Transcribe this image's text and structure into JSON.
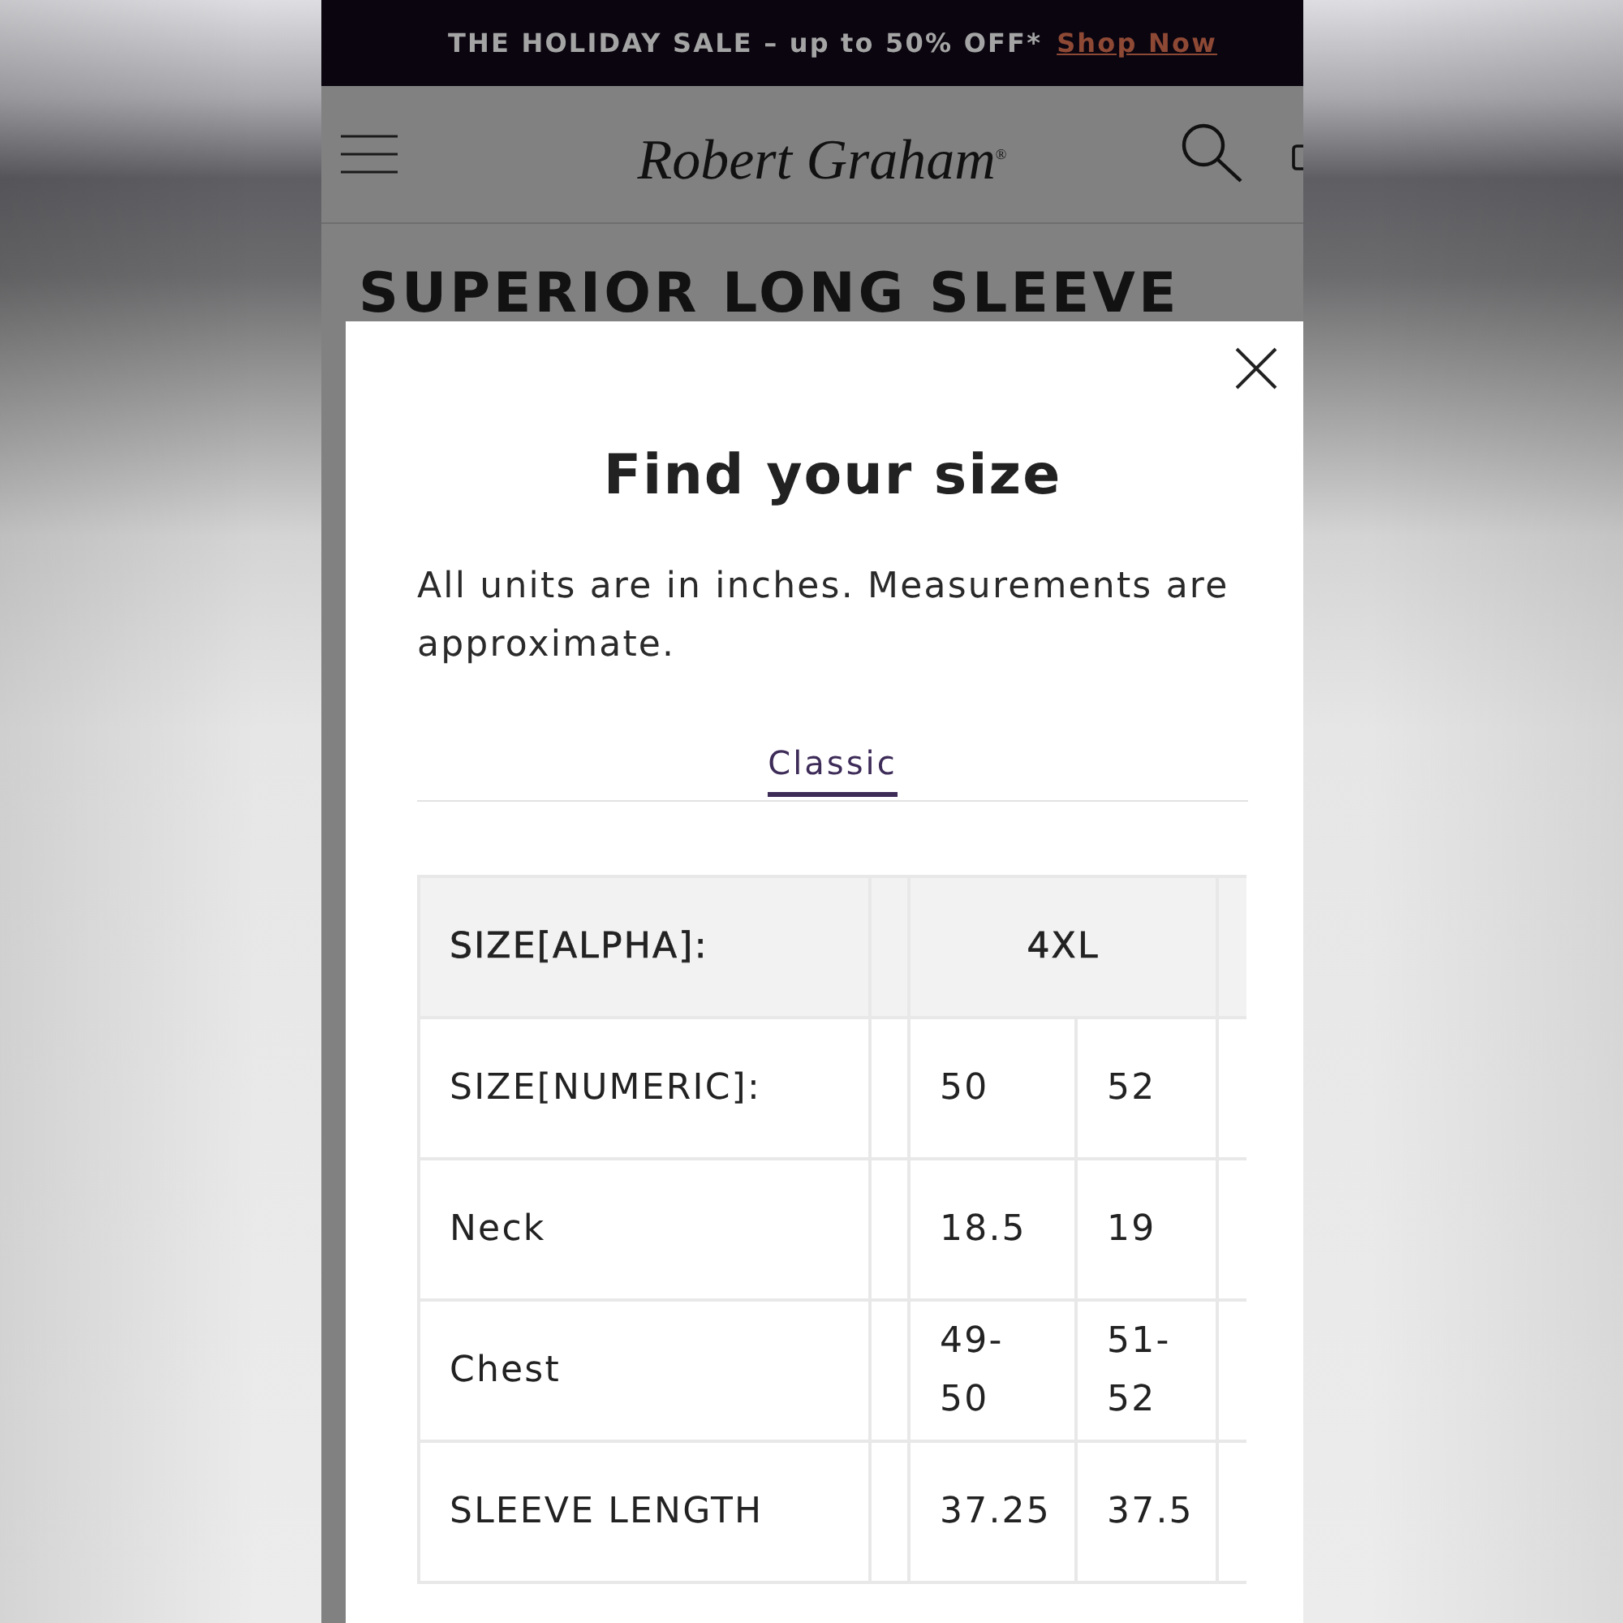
{
  "promo_banner": {
    "text": "THE HOLIDAY SALE – up to 50% OFF*",
    "link": "Shop Now"
  },
  "header": {
    "logo": "Robert Graham$^{®}$"
  },
  "page": {
    "title": "SUPERIOR LONG SLEEVE"
  },
  "size_modal": {
    "title": "Find your size",
    "note": "All units are in inches. Measurements are approximate.",
    "tabs": [
      {
        "label": "Classic",
        "selected": true
      }
    ],
    "table": {
      "header": {
        "label": "SIZE[ALPHA]:",
        "groups": [
          "4XL"
        ]
      },
      "rows": [
        {
          "label": "SIZE[NUMERIC]:",
          "values": [
            "50",
            "52"
          ]
        },
        {
          "label": "Neck",
          "values": [
            "18.5",
            "19"
          ]
        },
        {
          "label": "Chest",
          "values": [
            "49-50",
            "51-52"
          ]
        },
        {
          "label": "SLEEVE LENGTH",
          "values": [
            "37.25",
            "37.5"
          ]
        }
      ]
    }
  }
}
